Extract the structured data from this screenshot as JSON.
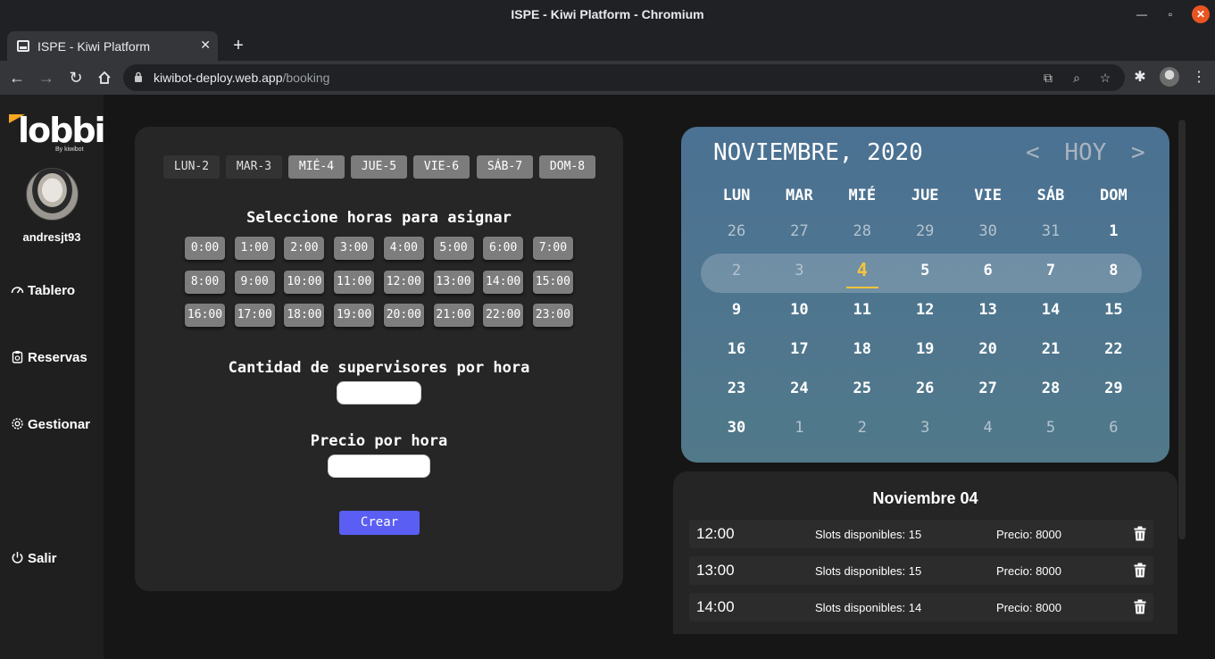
{
  "window": {
    "title": "ISPE - Kiwi Platform - Chromium"
  },
  "tab": {
    "title": "ISPE - Kiwi Platform"
  },
  "address": {
    "domain": "kiwibot-deploy.web.app",
    "path": "/booking"
  },
  "sidebar": {
    "logo_text": "lobbi",
    "logo_sub": "By kiwibot",
    "username": "andresjt93",
    "items": [
      {
        "label": "Tablero",
        "icon": "gauge-icon"
      },
      {
        "label": "Reservas",
        "icon": "clipboard-icon"
      },
      {
        "label": "Gestionar",
        "icon": "gear-icon"
      },
      {
        "label": "Salir",
        "icon": "power-icon"
      }
    ]
  },
  "scheduler": {
    "days": [
      {
        "label": "LUN-2",
        "state": "past"
      },
      {
        "label": "MAR-3",
        "state": "past"
      },
      {
        "label": "MIÉ-4",
        "state": "active"
      },
      {
        "label": "JUE-5",
        "state": "active"
      },
      {
        "label": "VIE-6",
        "state": "active"
      },
      {
        "label": "SÁB-7",
        "state": "active"
      },
      {
        "label": "DOM-8",
        "state": "active"
      }
    ],
    "hours_title": "Seleccione horas para asignar",
    "hours": [
      "0:00",
      "1:00",
      "2:00",
      "3:00",
      "4:00",
      "5:00",
      "6:00",
      "7:00",
      "8:00",
      "9:00",
      "10:00",
      "11:00",
      "12:00",
      "13:00",
      "14:00",
      "15:00",
      "16:00",
      "17:00",
      "18:00",
      "19:00",
      "20:00",
      "21:00",
      "22:00",
      "23:00"
    ],
    "supervisors_label": "Cantidad de supervisores por hora",
    "supervisors_value": "",
    "price_label": "Precio por hora",
    "price_value": "",
    "create_label": "Crear"
  },
  "calendar": {
    "month_label": "NOVIEMBRE, 2020",
    "prev": "<",
    "today": "HOY",
    "next": ">",
    "weekdays": [
      "LUN",
      "MAR",
      "MIÉ",
      "JUE",
      "VIE",
      "SÁB",
      "DOM"
    ],
    "weeks": [
      [
        "26",
        "27",
        "28",
        "29",
        "30",
        "31",
        "1"
      ],
      [
        "2",
        "3",
        "4",
        "5",
        "6",
        "7",
        "8"
      ],
      [
        "9",
        "10",
        "11",
        "12",
        "13",
        "14",
        "15"
      ],
      [
        "16",
        "17",
        "18",
        "19",
        "20",
        "21",
        "22"
      ],
      [
        "23",
        "24",
        "25",
        "26",
        "27",
        "28",
        "29"
      ],
      [
        "30",
        "1",
        "2",
        "3",
        "4",
        "5",
        "6"
      ]
    ],
    "selected_day": "4"
  },
  "day_panel": {
    "title": "Noviembre 04",
    "slots": [
      {
        "time": "12:00",
        "available": "Slots disponibles: 15",
        "price": "Precio: 8000"
      },
      {
        "time": "13:00",
        "available": "Slots disponibles: 15",
        "price": "Precio: 8000"
      },
      {
        "time": "14:00",
        "available": "Slots disponibles: 14",
        "price": "Precio: 8000"
      }
    ]
  },
  "colors": {
    "accent": "#5a5ef2",
    "today": "#f6c43c",
    "calendar_bg": "#4b7193"
  }
}
